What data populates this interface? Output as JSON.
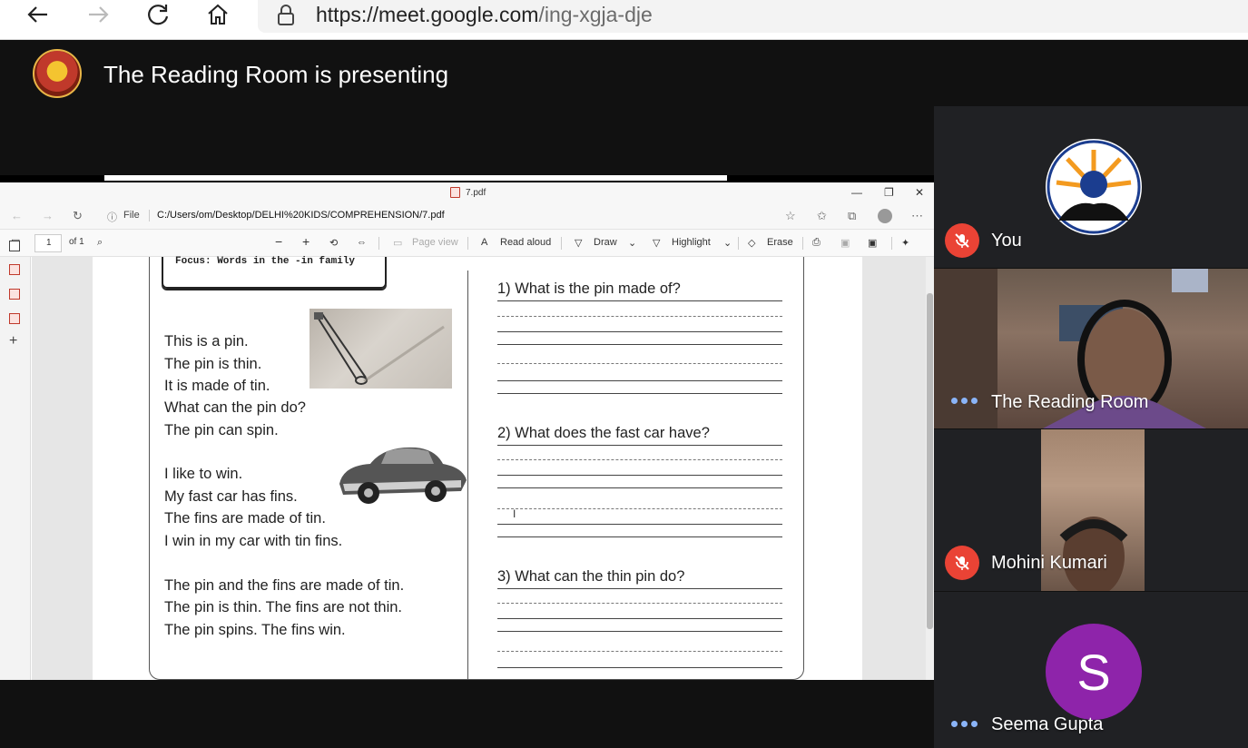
{
  "browser": {
    "url_host": "https://meet.google.com",
    "url_path": "/ing-xgja-dje"
  },
  "meet": {
    "presenting_title": "The Reading Room is presenting"
  },
  "pdf_window": {
    "tab_title": "7.pdf",
    "address_prefix": "File",
    "address_path": "C:/Users/om/Desktop/DELHI%20KIDS/COMPREHENSION/7.pdf",
    "page_number": "1",
    "page_total": "of 1",
    "toolbar": {
      "page_view": "Page view",
      "read_aloud": "Read aloud",
      "draw": "Draw",
      "highlight": "Highlight",
      "erase": "Erase"
    }
  },
  "worksheet": {
    "focus": "Focus: Words in the -in  family",
    "poem": [
      "This is a pin.",
      "The pin is thin.",
      "It is made of tin.",
      "What can the pin do?",
      "The pin can spin.",
      "I like to win.",
      "My fast car has fins.",
      "The fins are made of tin.",
      "I win in my car with tin fins.",
      "The pin and the fins are made of tin.",
      "The pin is thin. The fins are not thin.",
      "The pin spins. The fins win."
    ],
    "questions": [
      "1) What is the pin made of?",
      "2) What does the fast car have?",
      "3) What can the thin pin do?"
    ]
  },
  "participants": [
    {
      "name": "You",
      "muted": true
    },
    {
      "name": "The Reading Room",
      "muted": false
    },
    {
      "name": "Mohini Kumari",
      "muted": true
    },
    {
      "name": "Seema Gupta",
      "muted": false,
      "initial": "S"
    }
  ],
  "colors": {
    "mute_red": "#ea4335",
    "avatar_purple": "#8e24aa",
    "dots_blue": "#8ab4f8"
  }
}
